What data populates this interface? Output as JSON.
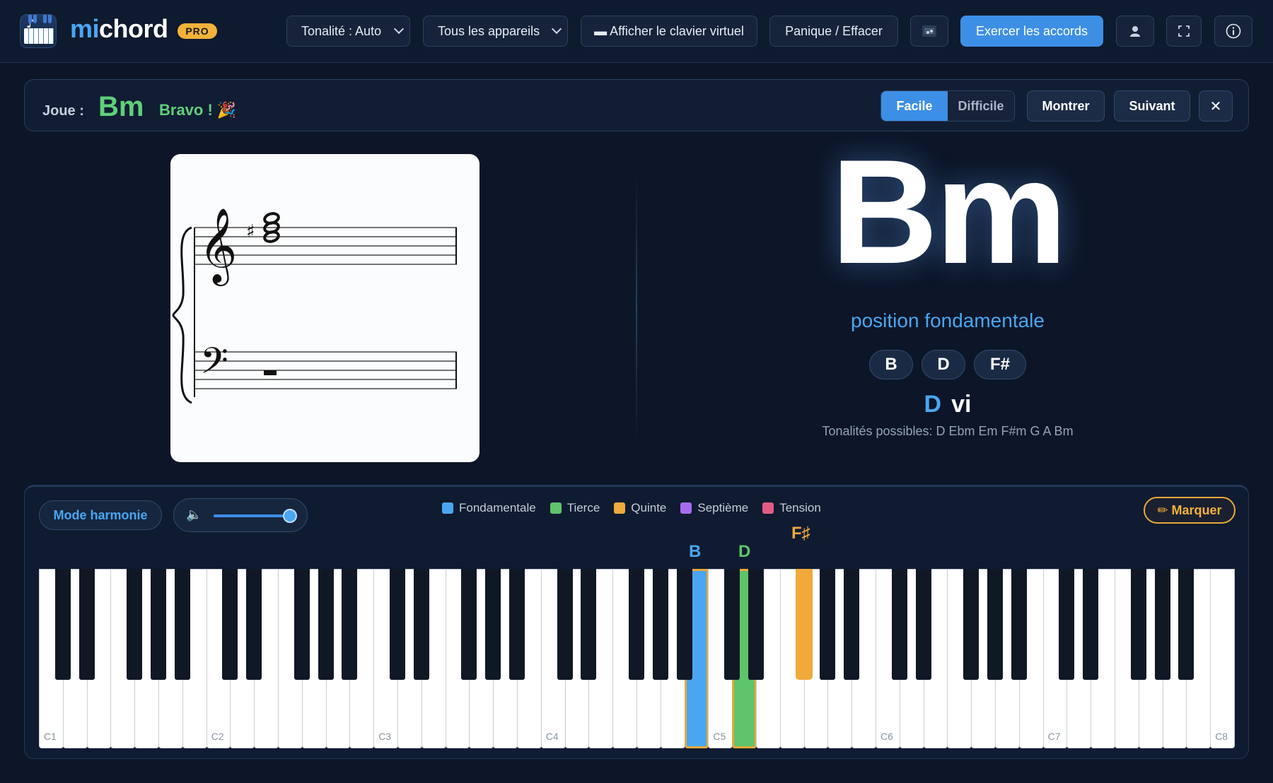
{
  "app": {
    "name_prefix": "mi",
    "name_suffix": "chord",
    "badge": "PRO"
  },
  "toolbar": {
    "key_select": "Tonalité : Auto",
    "device_select": "Tous les appareils",
    "virtual_keyboard": "▬ Afficher le clavier virtuel",
    "panic": "Panique / Effacer",
    "practice": "Exercer les accords"
  },
  "exercise": {
    "label": "Joue :",
    "target_chord": "Bm",
    "feedback": "Bravo ! 🎉",
    "difficulty": [
      {
        "label": "Facile",
        "active": true
      },
      {
        "label": "Difficile",
        "active": false
      }
    ],
    "show": "Montrer",
    "next": "Suivant",
    "close": "✕"
  },
  "chord": {
    "name": "Bm",
    "inversion": "position fondamentale",
    "notes": [
      "B",
      "D",
      "F#"
    ],
    "key": "D",
    "roman": "vi",
    "possible_keys": "Tonalités possibles: D Ebm Em F#m G A Bm"
  },
  "panel": {
    "mode": "Mode harmonie",
    "volume": 1.0,
    "legend": [
      {
        "label": "Fondamentale",
        "color": "#4aa6f0"
      },
      {
        "label": "Tierce",
        "color": "#5fc46b"
      },
      {
        "label": "Quinte",
        "color": "#f0a93a"
      },
      {
        "label": "Septième",
        "color": "#a66cf0"
      },
      {
        "label": "Tension",
        "color": "#e45c82"
      }
    ],
    "marquer": "✏ Marquer",
    "note_labels": [
      {
        "text": "B",
        "color": "#4aa6f0"
      },
      {
        "text": "D",
        "color": "#5fc46b"
      },
      {
        "text": "F♯",
        "color": "#f0a93a"
      }
    ],
    "octave_labels": [
      "C1",
      "C2",
      "C3",
      "C4",
      "C5",
      "C6",
      "C7",
      "C8"
    ]
  }
}
